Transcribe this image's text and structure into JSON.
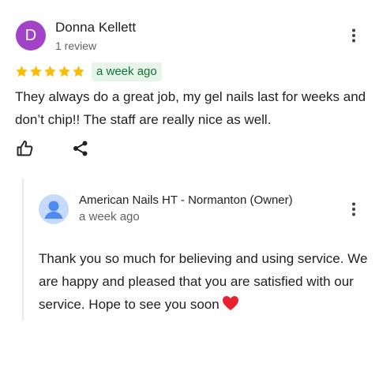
{
  "review": {
    "avatar_letter": "D",
    "avatar_color": "#a142c7",
    "reviewer_name": "Donna Kellett",
    "review_count": "1 review",
    "rating": 5,
    "date": "a week ago",
    "text": "They always do a great job, my gel nails last for weeks and don’t chip!! The staff are really nice as well."
  },
  "reply": {
    "owner_name": "American Nails HT - Normanton (Owner)",
    "date": "a week ago",
    "text": "Thank you so much for believing and using service. We are happy and pleased that you are satisfied with our service. Hope to see you soon"
  },
  "colors": {
    "star": "#fbbc04",
    "badge_bg": "#e6f4ea",
    "badge_text": "#137333",
    "heart": "#e8202f"
  },
  "icons": [
    "more-vert-icon",
    "thumbs-up-icon",
    "share-icon",
    "person-icon",
    "heart-emoji-icon",
    "star-icon"
  ]
}
